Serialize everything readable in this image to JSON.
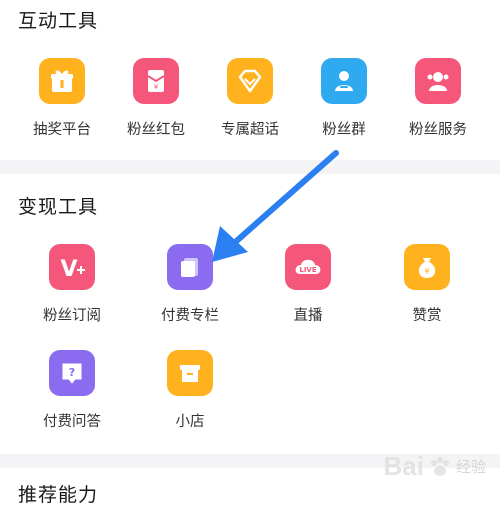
{
  "sections": {
    "interactive": {
      "title": "互动工具",
      "items": [
        {
          "label": "抽奖平台",
          "icon": "gift-icon",
          "color": "#ffb21e"
        },
        {
          "label": "粉丝红包",
          "icon": "red-envelope-icon",
          "color": "#f4577a"
        },
        {
          "label": "专属超话",
          "icon": "diamond-icon",
          "color": "#ffb21e"
        },
        {
          "label": "粉丝群",
          "icon": "group-icon",
          "color": "#2fa9ef"
        },
        {
          "label": "粉丝服务",
          "icon": "fan-service-icon",
          "color": "#f4577a"
        }
      ]
    },
    "monetize": {
      "title": "变现工具",
      "items": [
        {
          "label": "粉丝订阅",
          "icon": "v-plus-icon",
          "color": "#f4577a"
        },
        {
          "label": "付费专栏",
          "icon": "column-icon",
          "color": "#8b6cf0"
        },
        {
          "label": "直播",
          "icon": "live-icon",
          "color": "#f4577a"
        },
        {
          "label": "赞赏",
          "icon": "money-bag-icon",
          "color": "#ffb21e"
        },
        {
          "label": "付费问答",
          "icon": "question-icon",
          "color": "#8b6cf0"
        },
        {
          "label": "小店",
          "icon": "shop-icon",
          "color": "#ffb21e"
        }
      ]
    },
    "recommend": {
      "title": "推荐能力"
    }
  },
  "watermark": {
    "brand": "Bai",
    "suffix": "经验"
  },
  "accent": "#2b7ff0"
}
